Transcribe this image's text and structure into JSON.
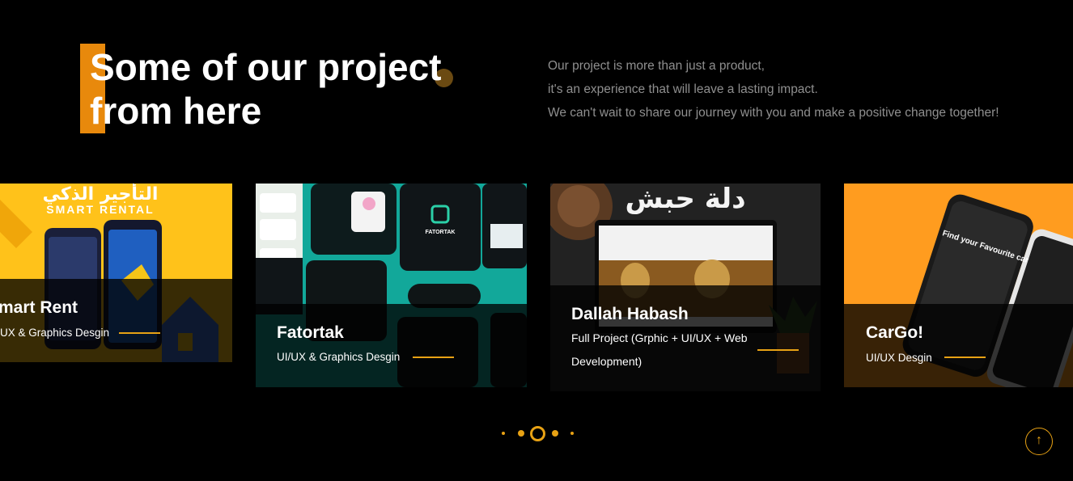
{
  "header": {
    "title_line1": "Some of our project",
    "title_line2": "from here",
    "intro_lines": [
      "Our project is more than just a product,",
      "it's an experience that will leave a lasting impact.",
      "We can't wait to share our journey with you and make a positive change together!"
    ]
  },
  "projects": [
    {
      "title": "mart Rent",
      "subtitle": "UX & Graphics Desgin",
      "art_arabic": "التأجير الذكي",
      "art_latin": "SMART RENTAL",
      "bg_color": "#ffc21a"
    },
    {
      "title": "Fatortak",
      "subtitle": "UI/UX & Graphics Desgin",
      "art_brand": "FATORTAK",
      "bg_color": "#0f1516"
    },
    {
      "title": "Dallah Habash",
      "subtitle_line1": "Full Project (Grphic + UI/UX + Web",
      "subtitle_line2": "Development)",
      "art_arabic": "دلة حبش",
      "bg_color": "#1e1e1e"
    },
    {
      "title": "CarGo!",
      "subtitle": "UI/UX Desgin",
      "art_phone_text": "Find your Favourite car",
      "bg_color": "#ff9c1f"
    }
  ],
  "pagination": {
    "pages": 5,
    "active_index": 2
  },
  "colors": {
    "accent": "#e8890c",
    "line": "#e8a214",
    "background": "#000000",
    "muted_text": "#8f8f8f"
  },
  "icons": {
    "scroll_top": "arrow-up-icon"
  }
}
